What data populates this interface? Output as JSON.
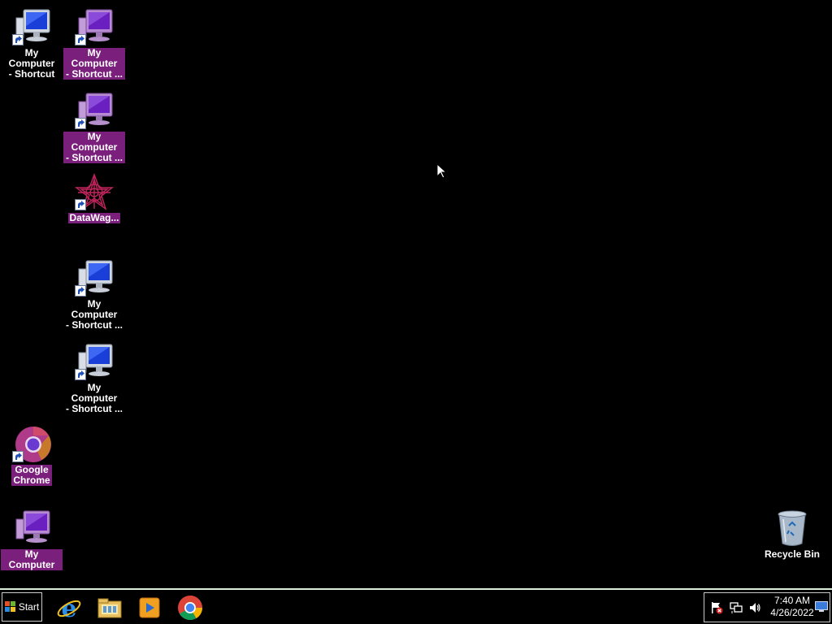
{
  "desktop": {
    "icons": [
      {
        "label": "My Computer\n- Shortcut",
        "type": "computer",
        "shortcut": true,
        "selected": false,
        "tint": "blue"
      },
      {
        "label": "My Computer\n- Shortcut ...",
        "type": "computer",
        "shortcut": true,
        "selected": true,
        "tint": "purple"
      },
      {
        "label": "My Computer\n- Shortcut ...",
        "type": "computer",
        "shortcut": true,
        "selected": true,
        "tint": "purple"
      },
      {
        "label": "DataWag...",
        "type": "datawagon",
        "shortcut": true,
        "selected": true
      },
      {
        "label": "My Computer\n- Shortcut ...",
        "type": "computer",
        "shortcut": true,
        "selected": false,
        "tint": "blue"
      },
      {
        "label": "My Computer\n- Shortcut ...",
        "type": "computer",
        "shortcut": true,
        "selected": false,
        "tint": "blue"
      },
      {
        "label": "Google\nChrome",
        "type": "chrome",
        "shortcut": true,
        "selected": true
      },
      {
        "label": "My Computer",
        "type": "computer",
        "shortcut": false,
        "selected": true,
        "tint": "purple"
      },
      {
        "label": "Recycle Bin",
        "type": "recycle-bin",
        "shortcut": false,
        "selected": false
      }
    ]
  },
  "taskbar": {
    "start_label": "Start",
    "pinned": [
      {
        "name": "internet-explorer-icon"
      },
      {
        "name": "file-explorer-icon"
      },
      {
        "name": "media-player-icon"
      },
      {
        "name": "chrome-icon"
      }
    ],
    "tray": {
      "time": "7:40 AM",
      "date": "4/26/2022",
      "icons": [
        "action-center-flag-icon",
        "network-icon",
        "volume-icon"
      ]
    }
  },
  "colors": {
    "desktop_bg": "#000000",
    "selection": "#7b1f7c",
    "taskbar_border": "#d8f0d8"
  }
}
